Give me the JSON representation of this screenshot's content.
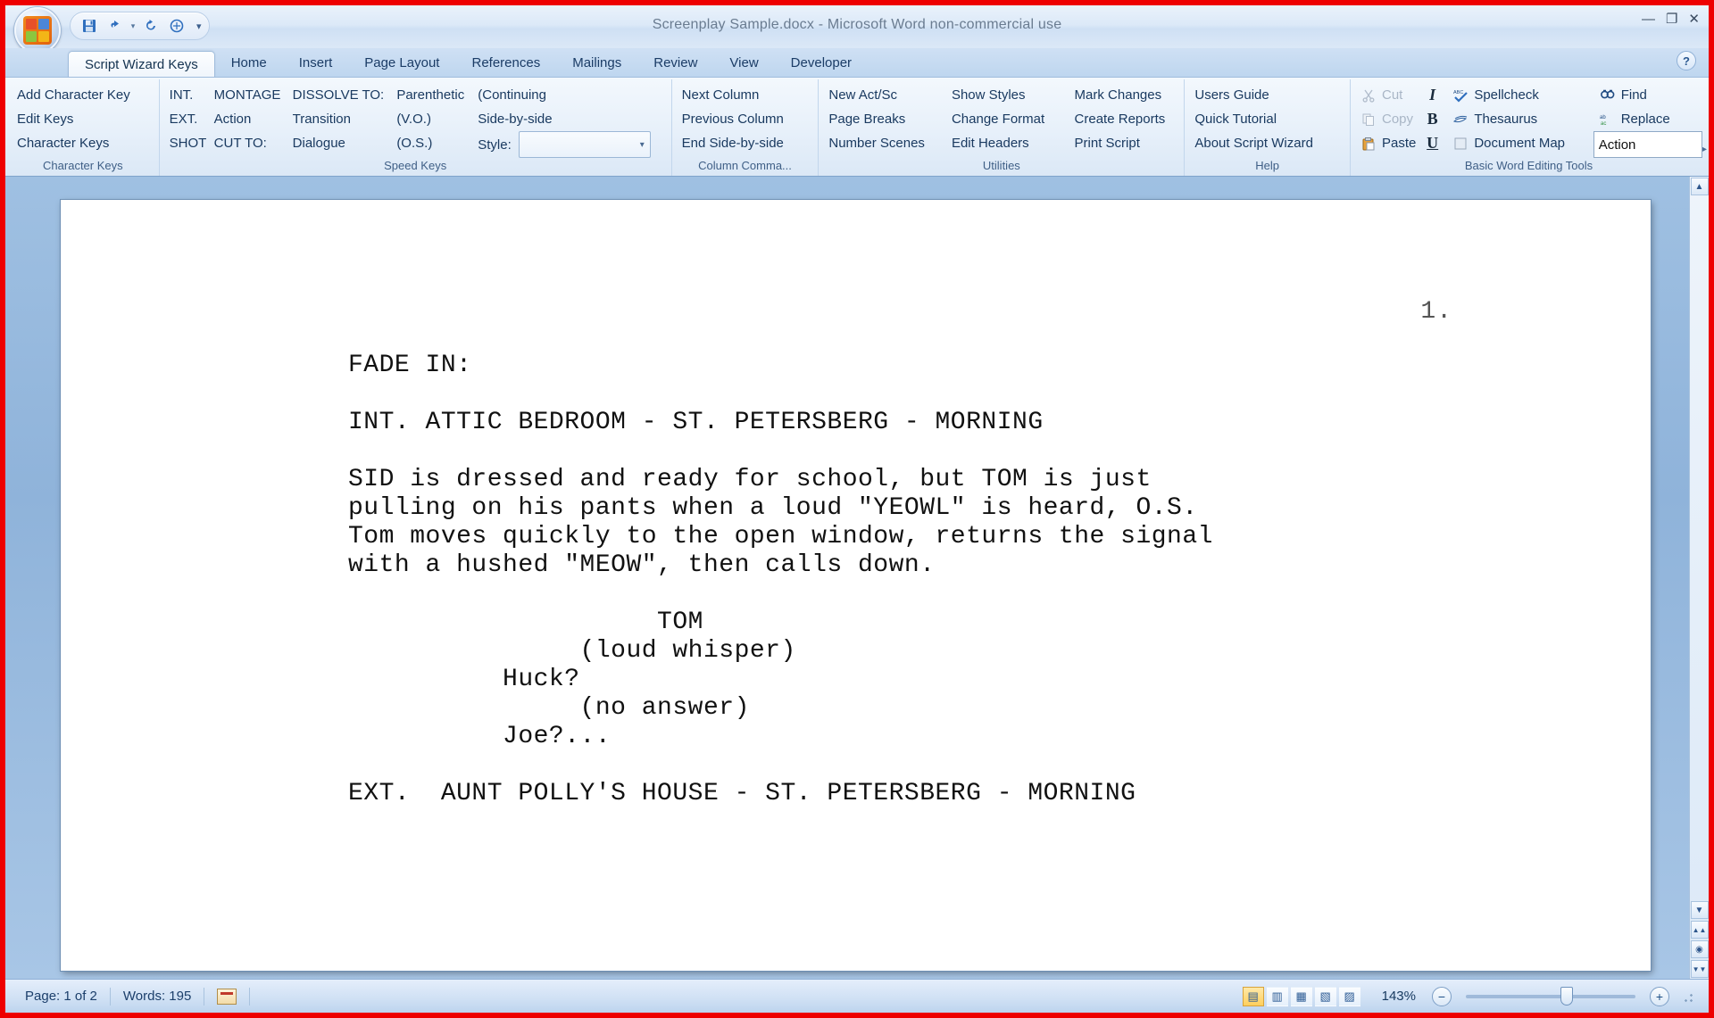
{
  "window": {
    "title": "Screenplay Sample.docx - Microsoft Word non-commercial use",
    "minimize": "—",
    "restore": "❐",
    "close": "✕",
    "help_label": "?"
  },
  "quick_access": {
    "save": "save-icon",
    "undo": "undo-icon",
    "undo_caret": "▾",
    "redo": "redo-icon",
    "print_preview": "print-preview-icon",
    "customize": "▾"
  },
  "tabs": [
    {
      "label": "Script Wizard Keys",
      "active": true
    },
    {
      "label": "Home",
      "active": false
    },
    {
      "label": "Insert",
      "active": false
    },
    {
      "label": "Page Layout",
      "active": false
    },
    {
      "label": "References",
      "active": false
    },
    {
      "label": "Mailings",
      "active": false
    },
    {
      "label": "Review",
      "active": false
    },
    {
      "label": "View",
      "active": false
    },
    {
      "label": "Developer",
      "active": false
    }
  ],
  "ribbon": {
    "groups": [
      {
        "name": "character-keys",
        "label": "Character Keys",
        "columns": [
          {
            "items": [
              {
                "label": "Add Character Key",
                "disabled": false
              },
              {
                "label": "Edit Keys",
                "disabled": false
              },
              {
                "label": "Character Keys",
                "disabled": false
              }
            ]
          }
        ]
      },
      {
        "name": "speed-keys",
        "label": "Speed Keys",
        "columns": [
          {
            "items": [
              {
                "label": "INT.",
                "disabled": false
              },
              {
                "label": "EXT.",
                "disabled": false
              },
              {
                "label": "SHOT",
                "disabled": false
              }
            ]
          },
          {
            "items": [
              {
                "label": "MONTAGE",
                "disabled": false
              },
              {
                "label": "Action",
                "disabled": false
              },
              {
                "label": "CUT TO:",
                "disabled": false
              }
            ]
          },
          {
            "items": [
              {
                "label": "DISSOLVE TO:",
                "disabled": false
              },
              {
                "label": "Transition",
                "disabled": false
              },
              {
                "label": "Dialogue",
                "disabled": false
              }
            ]
          },
          {
            "items": [
              {
                "label": "Parenthetic",
                "disabled": false
              },
              {
                "label": "(V.O.)",
                "disabled": false
              },
              {
                "label": "(O.S.)",
                "disabled": false
              }
            ]
          },
          {
            "items": [
              {
                "label": "(Continuing",
                "disabled": false
              },
              {
                "label": "Side-by-side",
                "disabled": false
              }
            ]
          }
        ],
        "style_label": "Style:",
        "style_value": "",
        "style_caret": "▾"
      },
      {
        "name": "column-commands",
        "label": "Column Comma...",
        "columns": [
          {
            "items": [
              {
                "label": "Next Column",
                "disabled": false
              },
              {
                "label": "Previous Column",
                "disabled": false
              },
              {
                "label": "End Side-by-side",
                "disabled": false
              }
            ]
          }
        ]
      },
      {
        "name": "utilities",
        "label": "Utilities",
        "columns": [
          {
            "items": [
              {
                "label": "New Act/Sc",
                "disabled": false
              },
              {
                "label": "Page Breaks",
                "disabled": false
              },
              {
                "label": "Number Scenes",
                "disabled": false
              }
            ]
          },
          {
            "items": [
              {
                "label": "Show Styles",
                "disabled": false
              },
              {
                "label": "Change Format",
                "disabled": false
              },
              {
                "label": "Edit Headers",
                "disabled": false
              }
            ]
          },
          {
            "items": [
              {
                "label": "Mark Changes",
                "disabled": false
              },
              {
                "label": "Create Reports",
                "disabled": false
              },
              {
                "label": "Print Script",
                "disabled": false
              }
            ]
          }
        ]
      },
      {
        "name": "help",
        "label": "Help",
        "columns": [
          {
            "items": [
              {
                "label": "Users Guide",
                "disabled": false
              },
              {
                "label": "Quick Tutorial",
                "disabled": false
              },
              {
                "label": "About Script Wizard",
                "disabled": false
              }
            ]
          }
        ]
      },
      {
        "name": "basic-word-editing-tools",
        "label": "Basic Word Editing Tools",
        "columns": [
          {
            "items": [
              {
                "label": "Cut",
                "icon": "scissors-icon",
                "disabled": true
              },
              {
                "label": "Copy",
                "icon": "copy-icon",
                "disabled": true
              },
              {
                "label": "Paste",
                "icon": "paste-icon",
                "disabled": false
              }
            ]
          },
          {
            "items": [
              {
                "label": "I",
                "icon": "italic-icon",
                "disabled": false
              },
              {
                "label": "B",
                "icon": "bold-icon",
                "disabled": false
              },
              {
                "label": "U",
                "icon": "underline-icon",
                "disabled": false
              }
            ]
          },
          {
            "items": [
              {
                "label": "Spellcheck",
                "icon": "spellcheck-icon",
                "disabled": false
              },
              {
                "label": "Thesaurus",
                "icon": "thesaurus-icon",
                "disabled": false
              },
              {
                "label": "Document Map",
                "icon": "document-map-icon",
                "disabled": false
              }
            ]
          },
          {
            "items": [
              {
                "label": "Find",
                "icon": "find-icon",
                "disabled": false
              },
              {
                "label": "Replace",
                "icon": "replace-icon",
                "disabled": false
              }
            ]
          }
        ],
        "action_field_value": "Action"
      }
    ],
    "overflow_caret": "▸"
  },
  "document": {
    "page_number": "1.",
    "lines": [
      "FADE IN:",
      "",
      "INT. ATTIC BEDROOM - ST. PETERSBERG - MORNING",
      "",
      "SID is dressed and ready for school, but TOM is just",
      "pulling on his pants when a loud \"YEOWL\" is heard, O.S.",
      "Tom moves quickly to the open window, returns the signal",
      "with a hushed \"MEOW\", then calls down.",
      "",
      "                    TOM",
      "               (loud whisper)",
      "          Huck?",
      "               (no answer)",
      "          Joe?...",
      "",
      "EXT.  AUNT POLLY'S HOUSE - ST. PETERSBERG - MORNING"
    ]
  },
  "scrollbar": {
    "up_arrow": "▲",
    "down_arrow": "▼",
    "prev_page": "⏫",
    "select_object": "◉",
    "next_page": "⏬",
    "split_handle": "▬"
  },
  "status_bar": {
    "page": "Page: 1 of 2",
    "words": "Words: 195",
    "proofing_icon": "proofing-errors-icon",
    "view_buttons": [
      {
        "name": "print-layout-view",
        "glyph": "▤",
        "active": true
      },
      {
        "name": "full-screen-reading-view",
        "glyph": "▥",
        "active": false
      },
      {
        "name": "web-layout-view",
        "glyph": "▦",
        "active": false
      },
      {
        "name": "outline-view",
        "glyph": "▧",
        "active": false
      },
      {
        "name": "draft-view",
        "glyph": "▨",
        "active": false
      }
    ],
    "zoom_percent": "143%",
    "zoom_out": "−",
    "zoom_in": "+"
  }
}
